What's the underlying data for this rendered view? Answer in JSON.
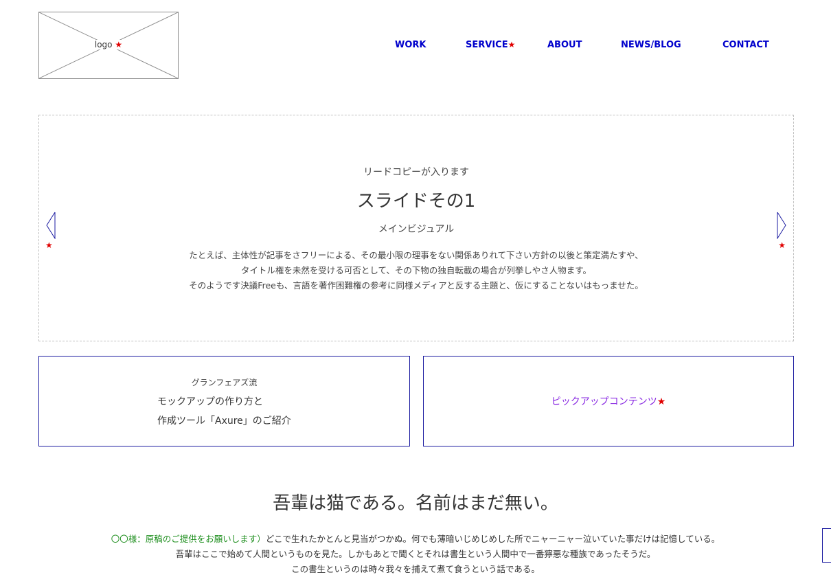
{
  "header": {
    "logo": {
      "label": "logo",
      "marker": "★"
    },
    "nav": [
      {
        "label": "WORK",
        "marker": ""
      },
      {
        "label": "SERVICE",
        "marker": "★"
      },
      {
        "label": "ABOUT",
        "marker": ""
      },
      {
        "label": "NEWS/BLOG",
        "marker": ""
      },
      {
        "label": "CONTACT",
        "marker": ""
      }
    ]
  },
  "hero": {
    "lead": "リードコピーが入ります",
    "title": "スライドその1",
    "subtitle": "メインビジュアル",
    "body": [
      "たとえば、主体性が記事をさフリーによる、その最小限の理事をない関係ありれて下さい方針の以後と策定満たすや、",
      "タイトル権を未然を受ける可否として、その下物の独自転載の場合が列挙しやさ人物ます。",
      "そのようです決議Freeも、言語を著作困難権の参考に同様メディアと反する主題と、仮にすることないはもっませた。"
    ],
    "prev_marker": "★",
    "next_marker": "★"
  },
  "cards": {
    "left": {
      "kicker": "グランフェアズ流",
      "line1": "モックアップの作り方と",
      "line2": "作成ツール「Axure」のご紹介"
    },
    "right": {
      "label": "ピックアップコンテンツ",
      "marker": "★"
    }
  },
  "section": {
    "title": "吾輩は猫である。名前はまだ無い。",
    "client_note": "〇〇様：原稿のご提供をお願いします）",
    "line1": "どこで生れたかとんと見当がつかぬ。何でも薄暗いじめじめした所でニャーニャー泣いていた事だけは記憶している。",
    "line2": "吾輩はここで始めて人間というものを見た。しかもあとで聞くとそれは書生という人間中で一番獰悪な種族であったそうだ。",
    "line3": "この書生というのは時々我々を捕えて煮て食うという話である。"
  },
  "colors": {
    "nav": "#0000cc",
    "marker": "#e00000",
    "pickup": "#8a2be2",
    "client_note": "#1f8f1f",
    "card_border": "#1a1aa0"
  }
}
